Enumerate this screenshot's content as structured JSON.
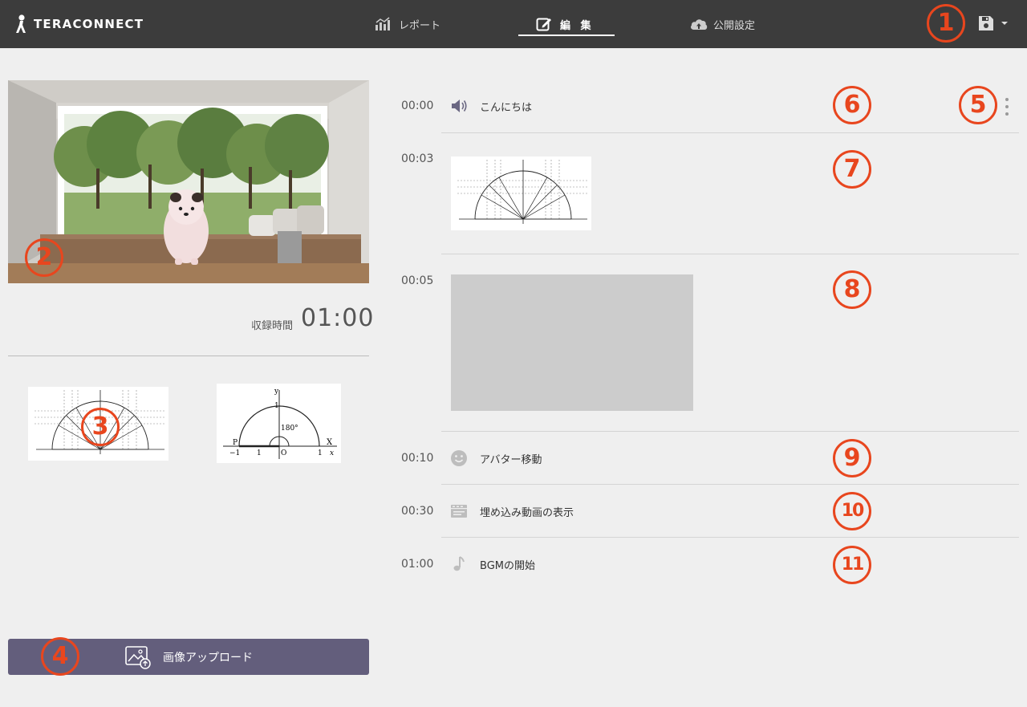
{
  "header": {
    "brand": "TERACONNECT",
    "tabs": [
      {
        "label": "レポート",
        "icon": "bar-chart-icon",
        "active": false
      },
      {
        "label": "編 集",
        "icon": "edit-icon",
        "active": true
      },
      {
        "label": "公開設定",
        "icon": "cloud-upload-icon",
        "active": false
      }
    ],
    "save_icon": "floppy-disk-icon"
  },
  "left": {
    "recording_label": "収録時間",
    "recording_time": "01:00",
    "thumbnail2_text": {
      "y": "y",
      "one": "1",
      "angle": "180°",
      "p": "P",
      "minus_one": "−1",
      "one_b": "1",
      "o": "O",
      "one_c": "1",
      "X": "X",
      "x": "x"
    },
    "upload_label": "画像アップロード"
  },
  "timeline": {
    "items": [
      {
        "time": "00:00",
        "icon": "speaker-icon",
        "label": "こんにちは"
      },
      {
        "time": "00:03",
        "icon": "image",
        "label": ""
      },
      {
        "time": "00:05",
        "icon": "video-placeholder",
        "label": ""
      },
      {
        "time": "00:10",
        "icon": "smiley-icon",
        "label": "アバター移動"
      },
      {
        "time": "00:30",
        "icon": "embed-video-icon",
        "label": "埋め込み動画の表示"
      },
      {
        "time": "01:00",
        "icon": "music-note-icon",
        "label": "BGMの開始"
      }
    ]
  },
  "callouts": [
    "1",
    "2",
    "3",
    "4",
    "5",
    "6",
    "7",
    "8",
    "9",
    "10",
    "11"
  ],
  "colors": {
    "header_bg": "#3c3c3c",
    "page_bg": "#efefef",
    "accent_button": "#635e7c",
    "callout": "#e8461e"
  }
}
